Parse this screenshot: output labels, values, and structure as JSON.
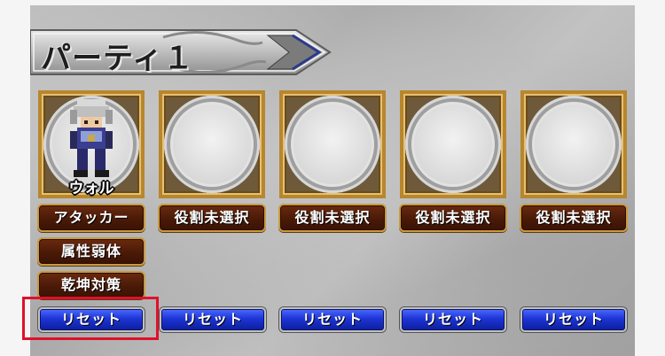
{
  "party": {
    "title": "パーティ１"
  },
  "slots": [
    {
      "character_name": "ウォル",
      "roles": [
        "アタッカー",
        "属性弱体",
        "乾坤対策"
      ],
      "reset_label": "リセット"
    },
    {
      "character_name": "",
      "roles": [
        "役割未選択"
      ],
      "reset_label": "リセット"
    },
    {
      "character_name": "",
      "roles": [
        "役割未選択"
      ],
      "reset_label": "リセット"
    },
    {
      "character_name": "",
      "roles": [
        "役割未選択"
      ],
      "reset_label": "リセット"
    },
    {
      "character_name": "",
      "roles": [
        "役割未選択"
      ],
      "reset_label": "リセット"
    }
  ],
  "colors": {
    "highlight": "#e0102a",
    "frame_gold": "#b8862e",
    "role_button": "#4a1a07",
    "reset_button": "#1d35d6"
  }
}
